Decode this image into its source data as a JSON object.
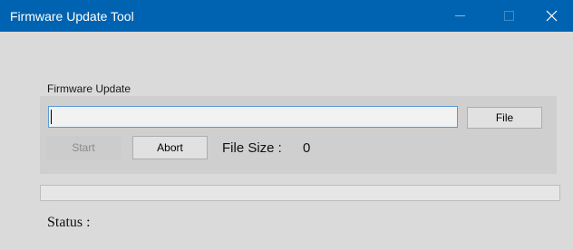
{
  "window": {
    "title": "Firmware Update Tool",
    "title_bar_color": "#0063b1",
    "controls": {
      "minimize_icon": "minimize-icon",
      "maximize_icon": "maximize-icon",
      "close_icon": "close-icon"
    }
  },
  "firmware_update": {
    "group_label": "Firmware Update",
    "path_value": "",
    "file_button_label": "File",
    "start_button_label": "Start",
    "start_button_enabled": false,
    "abort_button_label": "Abort",
    "file_size_label": "File Size :",
    "file_size_value": "0"
  },
  "progress": {
    "percent": 0
  },
  "status": {
    "label": "Status :"
  }
}
